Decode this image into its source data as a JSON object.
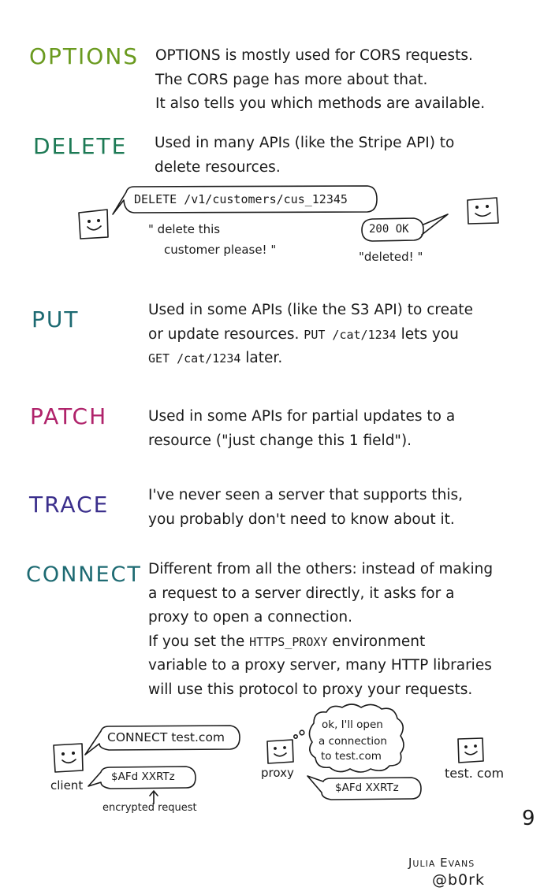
{
  "colors": {
    "options": "#6a9a1f",
    "delete": "#1d7a55",
    "put": "#1d6a72",
    "patch": "#b0236b",
    "trace": "#3b2f8c",
    "connect": "#1d6a72",
    "ink": "#1a1a1a"
  },
  "options": {
    "name": "OPTIONS",
    "lines": [
      "OPTIONS is mostly used for CORS requests.",
      "The CORS page has more about that.",
      "It also tells you which methods are available."
    ]
  },
  "delete": {
    "name": "DELETE",
    "lines": [
      "Used in many APIs (like the Stripe API) to",
      "delete resources."
    ],
    "request": "DELETE /v1/customers/cus_12345",
    "client_quote_1": "\" delete this",
    "client_quote_2": "customer please! \"",
    "response": "200 OK",
    "server_quote": "\"deleted! \""
  },
  "put": {
    "name": "PUT",
    "line1": "Used in some APIs (like the S3 API) to create",
    "line2_pre": "or update resources.",
    "line2_code": "PUT /cat/1234",
    "line2_post": "lets you",
    "line3_code": "GET /cat/1234",
    "line3_post": "later."
  },
  "patch": {
    "name": "PATCH",
    "lines": [
      "Used in some APIs for partial updates to a",
      "resource (\"just change this 1 field\")."
    ]
  },
  "trace": {
    "name": "TRACE",
    "lines": [
      "I've never seen a server that supports this,",
      "you probably don't need to know about it."
    ]
  },
  "connect": {
    "name": "CONNECT",
    "lines": [
      "Different from all the others: instead of making",
      "a request to a server directly, it asks for a",
      "proxy to open a connection."
    ],
    "line4_pre": "If you set the",
    "line4_code": "HTTPS_PROXY",
    "line4_post": "environment",
    "lines2": [
      "variable to a proxy server, many HTTP libraries",
      "will use this protocol to proxy your requests."
    ],
    "client_label": "client",
    "client_request": "CONNECT test.com",
    "client_encrypted": "$AFd XXRTz",
    "encrypted_label": "encrypted request",
    "proxy_label": "proxy",
    "proxy_thought_1": "ok, I'll open",
    "proxy_thought_2": "a connection",
    "proxy_thought_3": "to test.com",
    "proxy_encrypted": "$AFd XXRTz",
    "server_label": "test. com"
  },
  "page_number": "9",
  "signature_name": "Julia Evans",
  "signature_handle": "@b0rk"
}
